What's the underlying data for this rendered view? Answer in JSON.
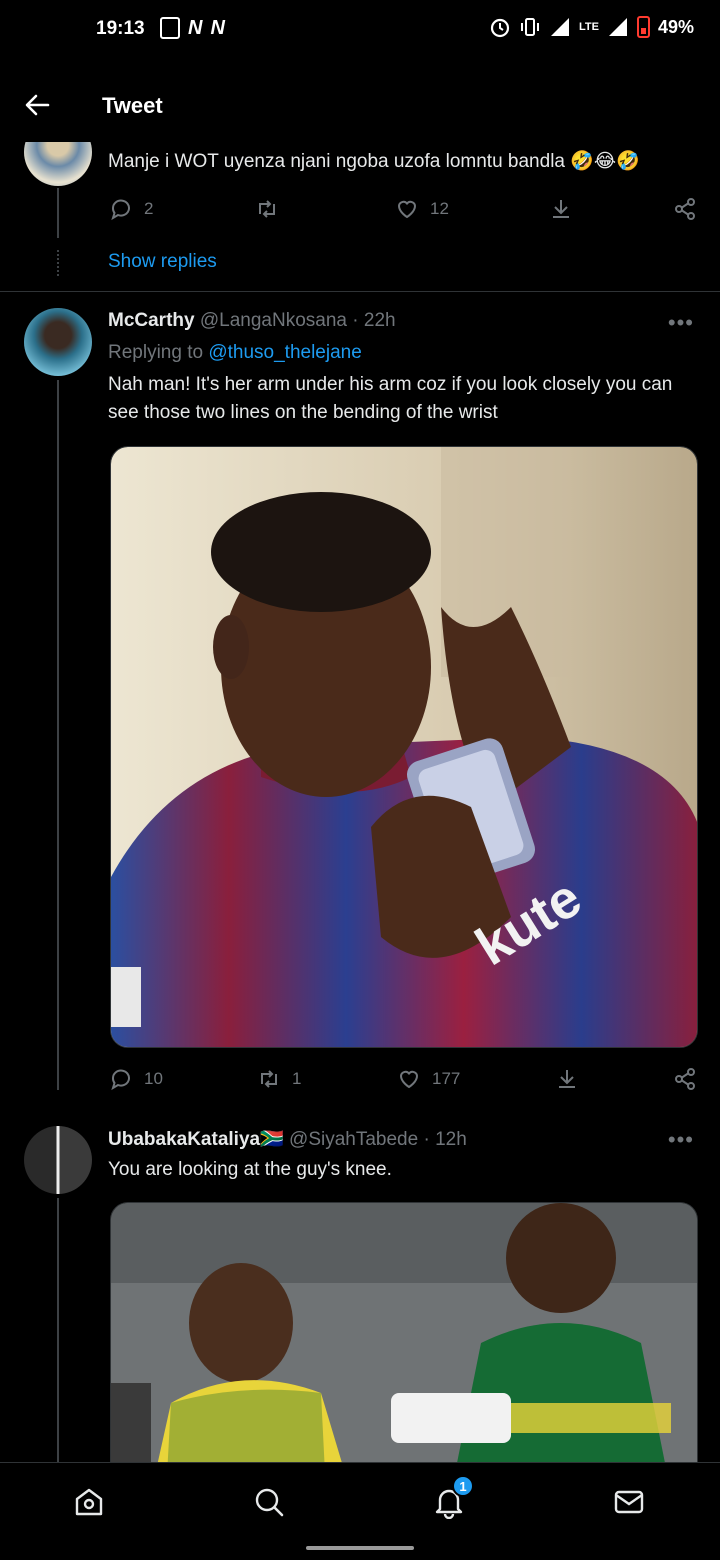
{
  "status_bar": {
    "time": "19:13",
    "network": "LTE",
    "battery": "49%"
  },
  "header": {
    "title": "Tweet"
  },
  "tweet1": {
    "text": "Manje i WOT uyenza njani ngoba uzofa lomntu bandla 🤣😂🤣",
    "replies": "2",
    "likes": "12",
    "show_replies": "Show replies"
  },
  "tweet2": {
    "name": "McCarthy",
    "handle": "@LangaNkosana",
    "time": "· 22h",
    "replying_prefix": "Replying to",
    "replying_to": "@thuso_thelejane",
    "text": "Nah man! It's her arm under his arm coz if you look closely you can see those two lines on the bending of the wrist",
    "replies": "10",
    "retweets": "1",
    "likes": "177"
  },
  "tweet3": {
    "name": "UbabakaKataliya",
    "flag": "🇿🇦",
    "handle": "@SiyahTabede",
    "time": "· 12h",
    "text": "You are looking at the guy's knee."
  },
  "nav": {
    "notifications_badge": "1"
  },
  "colors": {
    "accent": "#1d9bf0",
    "muted": "#71767b",
    "background": "#000000"
  },
  "icons": [
    "back-arrow-icon",
    "reply-icon",
    "retweet-icon",
    "like-icon",
    "share-icon",
    "more-icon",
    "home-icon",
    "search-icon",
    "bell-icon",
    "mail-icon"
  ]
}
